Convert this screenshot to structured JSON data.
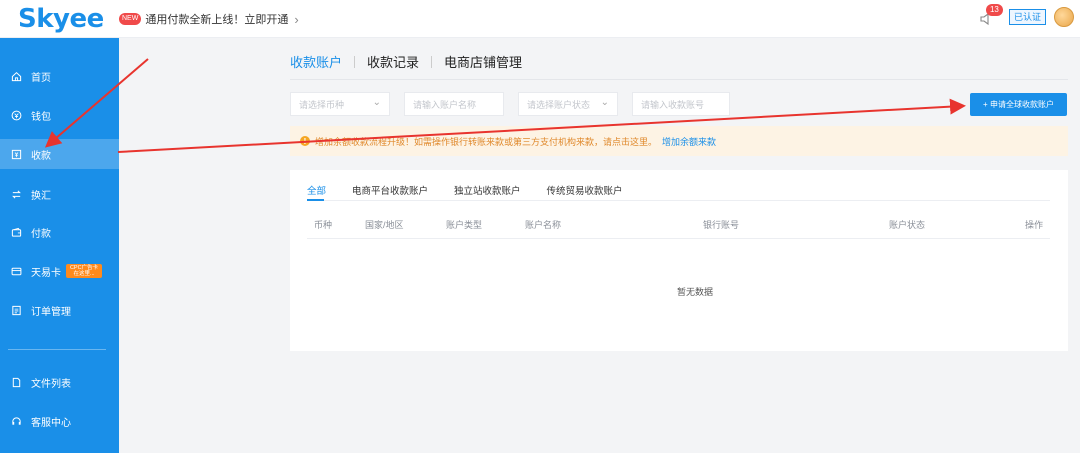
{
  "header": {
    "logo": "Skyee",
    "new_badge": "NEW",
    "notice": "通用付款全新上线！立即开通",
    "notice_chevron": "›",
    "notification_count": "13",
    "verified": "已认证"
  },
  "sidebar": {
    "items": [
      {
        "label": "首页",
        "icon": "home-icon"
      },
      {
        "label": "钱包",
        "icon": "wallet-icon"
      },
      {
        "label": "收款",
        "icon": "receive-icon"
      },
      {
        "label": "换汇",
        "icon": "exchange-icon"
      },
      {
        "label": "付款",
        "icon": "payment-icon"
      },
      {
        "label": "天易卡",
        "icon": "card-icon",
        "promo": "CPC广告卡 在这里..."
      },
      {
        "label": "订单管理",
        "icon": "order-icon"
      },
      {
        "label": "文件列表",
        "icon": "file-icon"
      },
      {
        "label": "客服中心",
        "icon": "support-icon"
      }
    ],
    "active_index": 2
  },
  "main": {
    "tabs": [
      {
        "label": "收款账户"
      },
      {
        "label": "收款记录"
      },
      {
        "label": "电商店铺管理"
      }
    ],
    "active_tab": 0,
    "filters": {
      "currency_placeholder": "请选择币种",
      "account_name_placeholder": "请输入账户名称",
      "status_placeholder": "请选择账户状态",
      "account_number_placeholder": "请输入收款账号"
    },
    "apply_button": "+ 申请全球收款账户",
    "alert": {
      "text": "增加余额收款流程升级！如需操作银行转账来款或第三方支付机构来款，请点击这里。",
      "link": "增加余额来款"
    },
    "subtabs": [
      {
        "label": "全部"
      },
      {
        "label": "电商平台收款账户"
      },
      {
        "label": "独立站收款账户"
      },
      {
        "label": "传统贸易收款账户"
      }
    ],
    "active_subtab": 0,
    "table_headers": [
      "币种",
      "国家/地区",
      "账户类型",
      "账户名称",
      "银行账号",
      "账户状态",
      "操作"
    ],
    "empty_text": "暂无数据"
  },
  "colors": {
    "brand": "#1a8fe8",
    "annotation": "#e8342e",
    "alert_text": "#e0892c",
    "promo": "#ff8a1c"
  }
}
